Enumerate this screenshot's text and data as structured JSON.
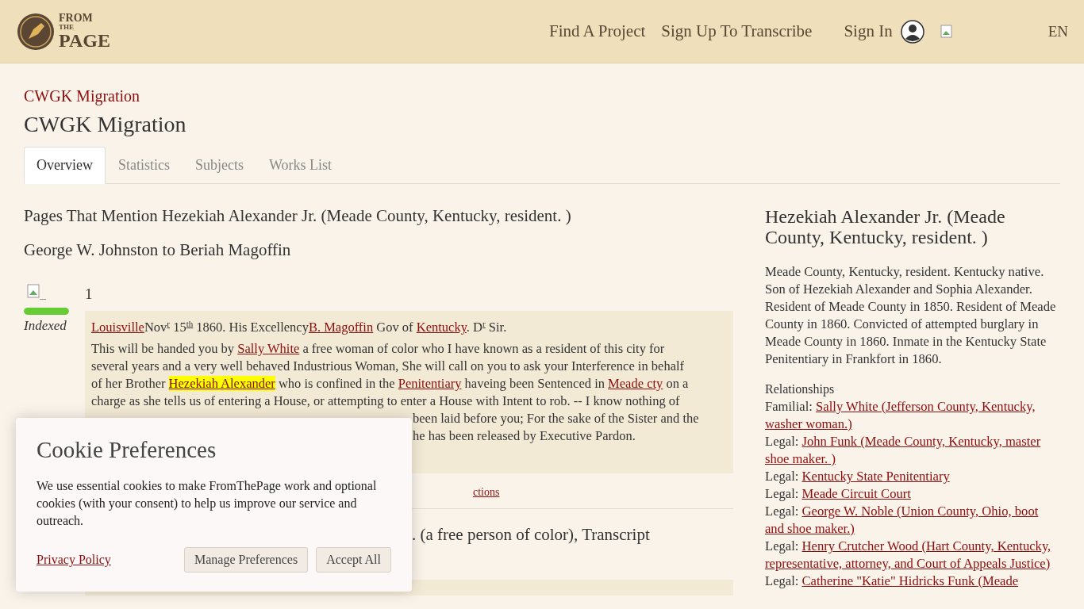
{
  "header": {
    "logo": {
      "top": "FROM",
      "middle": "THE",
      "bottom": "PAGE"
    },
    "nav": [
      {
        "label": "Find A Project"
      },
      {
        "label": "Sign Up To Transcribe"
      }
    ],
    "sign_in": "Sign In",
    "language": "EN"
  },
  "breadcrumb": "CWGK Migration",
  "title": "CWGK Migration",
  "tabs": [
    {
      "label": "Overview",
      "selected": true
    },
    {
      "label": "Statistics",
      "selected": false
    },
    {
      "label": "Subjects",
      "selected": false
    },
    {
      "label": "Works List",
      "selected": false
    }
  ],
  "main": {
    "heading": "Pages That Mention Hezekiah Alexander Jr. (Meade County, Kentucky, resident. )",
    "work_title": "George W. Johnston to Beriah Magoffin",
    "pages": [
      {
        "number": "1",
        "status": "Indexed",
        "level": 1,
        "lines": [
          {
            "kind": "full",
            "runs": [
              {
                "kind": "link",
                "text": "Louisville"
              },
              {
                "kind": "text",
                "text": "Nov$^{r}$ 15$^{th}$ 1860. His Excellency"
              },
              {
                "kind": "link",
                "text": "B. Magoffin"
              },
              {
                "kind": "text",
                "text": " Gov of "
              },
              {
                "kind": "link",
                "text": "Kentucky"
              },
              {
                "kind": "text",
                "text": ". D$^{r}$ Sir."
              }
            ]
          },
          {
            "kind": "full",
            "runs": [
              {
                "kind": "text",
                "text": "This will be handed you by "
              },
              {
                "kind": "link",
                "text": "Sally White"
              },
              {
                "kind": "text",
                "text": " a free woman of color who I have known as a resident of this city for"
              }
            ]
          },
          {
            "kind": "full",
            "runs": [
              {
                "kind": "text",
                "text": "several years and a very well behaved Industrious Woman, She will call on you to ask your Interference in behalf"
              }
            ]
          },
          {
            "kind": "full",
            "runs": [
              {
                "kind": "text",
                "text": "of her Brother "
              },
              {
                "kind": "highlight",
                "text": "Hezekiah Alexander"
              },
              {
                "kind": "text",
                "text": " who is confined in the "
              },
              {
                "kind": "link",
                "text": "Penitentiary"
              },
              {
                "kind": "text",
                "text": " haveing been Sentenced in "
              },
              {
                "kind": "link",
                "text": "Meade cty"
              },
              {
                "kind": "text",
                "text": " on a"
              }
            ]
          },
          {
            "kind": "full",
            "runs": [
              {
                "kind": "text",
                "text": "charge as she tells us of entering a House, or attempting to enter a House with Intent to rob. -- I know nothing of"
              }
            ]
          },
          {
            "kind": "partial",
            "runs": [
              {
                "kind": "text",
                "text": "been laid before you; For the sake of the Sister and the"
              }
            ]
          },
          {
            "kind": "partial",
            "runs": [
              {
                "kind": "text",
                "text": "he has been released by Executive Pardon."
              }
            ]
          }
        ],
        "footer_link": "ctions"
      }
    ],
    "next": {
      "title": ". (a free person of color), Transcript",
      "level": 1
    }
  },
  "sidebar": {
    "title": "Hezekiah Alexander Jr. (Meade County, Kentucky, resident. )",
    "description": "Meade County, Kentucky, resident. Kentucky native. Son of Hezekiah Alexander and Sophia Alexander. Resident of Meade County in 1850. Resident of Meade County in 1860. Convicted of attempted burglary in Meade County in 1860. Inmate in the Kentucky State Penitentiary in Frankfort in 1860.",
    "relationships_label": "Relationships",
    "relationships": [
      {
        "type": "Familial:",
        "name": "Sally White (Jefferson County, Kentucky, washer woman.)"
      },
      {
        "type": "Legal:",
        "name": "John Funk (Meade County, Kentucky, master shoe maker. )"
      },
      {
        "type": "Legal:",
        "name": "Kentucky State Penitentiary"
      },
      {
        "type": "Legal:",
        "name": "Meade Circuit Court"
      },
      {
        "type": "Legal:",
        "name": "George W. Noble (Union County, Ohio, boot and shoe maker.)"
      },
      {
        "type": "Legal:",
        "name": "Henry Crutcher Wood (Hart County, Kentucky, representative, attorney, and Court of Appeals Justice)"
      },
      {
        "type": "Legal:",
        "name": "Catherine \"Katie\" Hidricks Funk (Meade"
      }
    ]
  },
  "cookie": {
    "title": "Cookie Preferences",
    "text": "We use essential cookies to make FromThePage work and optional cookies (with your consent) to help us improve our service and outreach.",
    "privacy_link": "Privacy Policy",
    "buttons": [
      "Manage Preferences",
      "Accept All"
    ]
  }
}
